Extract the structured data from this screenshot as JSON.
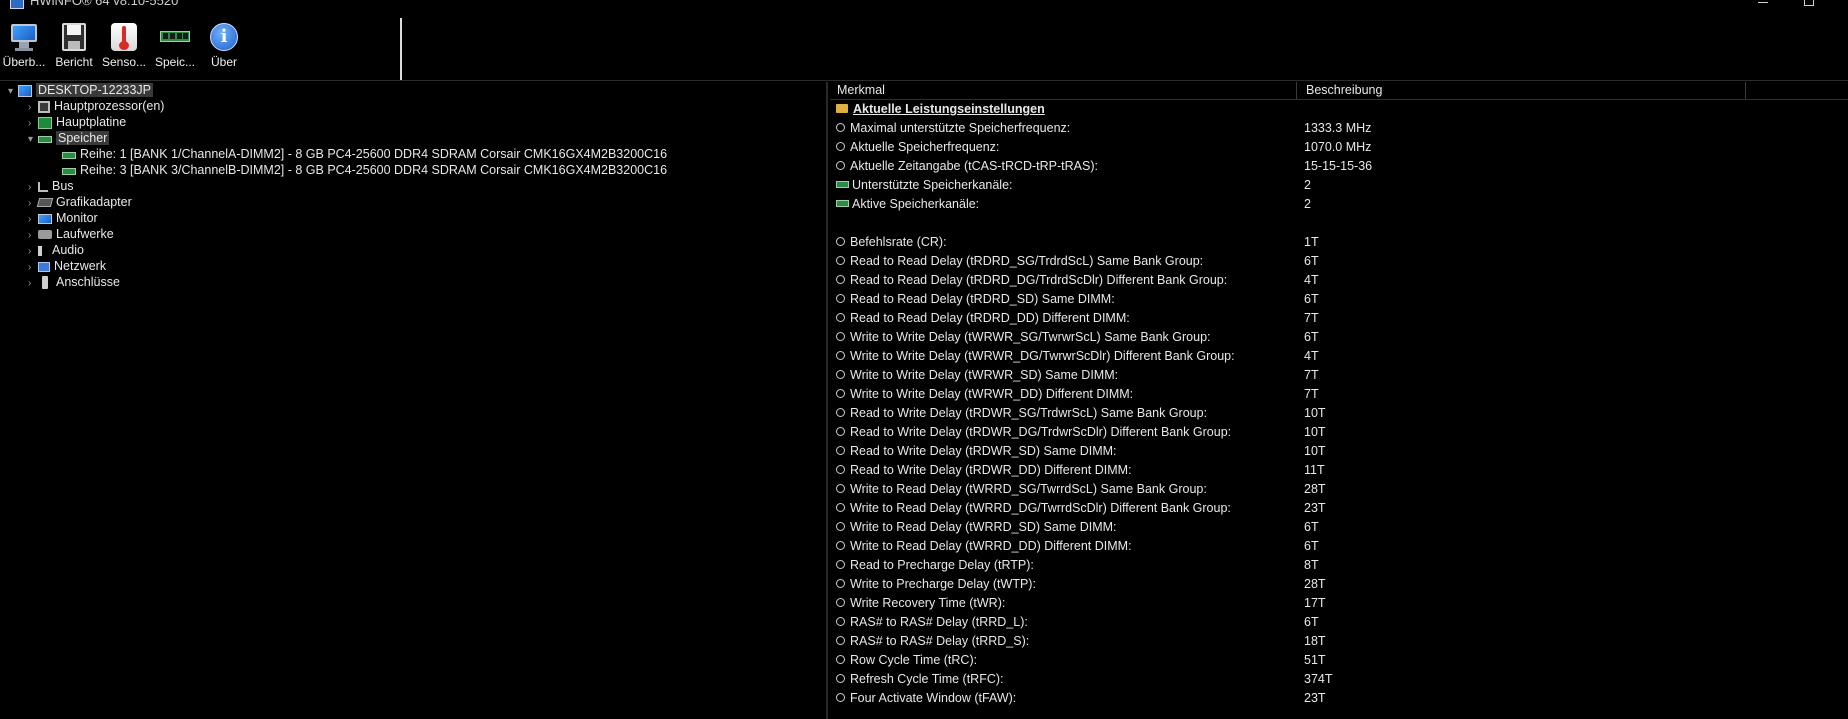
{
  "window": {
    "title": "HWiNFO® 64 v8.10-5520"
  },
  "toolbar": [
    {
      "label": "Überb...",
      "icon": "monitor-icon"
    },
    {
      "label": "Bericht",
      "icon": "save-icon"
    },
    {
      "label": "Senso...",
      "icon": "thermometer-icon"
    },
    {
      "label": "Speic...",
      "icon": "ram-icon"
    },
    {
      "label": "Über",
      "icon": "info-icon"
    }
  ],
  "tree": [
    {
      "label": "DESKTOP-12233JP",
      "icon": "computer-icon",
      "arrow": "▾",
      "level": 0,
      "selected": false
    },
    {
      "label": "Hauptprozessor(en)",
      "icon": "cpu-icon",
      "arrow": "›",
      "level": 1,
      "selected": false
    },
    {
      "label": "Hauptplatine",
      "icon": "motherboard-icon",
      "arrow": "›",
      "level": 1,
      "selected": false
    },
    {
      "label": "Speicher",
      "icon": "memory-icon",
      "arrow": "▾",
      "level": 1,
      "selected": true
    },
    {
      "label": "Reihe: 1 [BANK 1/ChannelA-DIMM2] - 8 GB PC4-25600 DDR4 SDRAM Corsair CMK16GX4M2B3200C16",
      "icon": "ram-module-icon",
      "arrow": "",
      "level": 2,
      "selected": false
    },
    {
      "label": "Reihe: 3 [BANK 3/ChannelB-DIMM2] - 8 GB PC4-25600 DDR4 SDRAM Corsair CMK16GX4M2B3200C16",
      "icon": "ram-module-icon",
      "arrow": "",
      "level": 2,
      "selected": false
    },
    {
      "label": "Bus",
      "icon": "bus-icon",
      "arrow": "›",
      "level": 1,
      "selected": false
    },
    {
      "label": "Grafikadapter",
      "icon": "gpu-icon",
      "arrow": "›",
      "level": 1,
      "selected": false
    },
    {
      "label": "Monitor",
      "icon": "monitor-icon",
      "arrow": "›",
      "level": 1,
      "selected": false
    },
    {
      "label": "Laufwerke",
      "icon": "drive-icon",
      "arrow": "›",
      "level": 1,
      "selected": false
    },
    {
      "label": "Audio",
      "icon": "audio-icon",
      "arrow": "›",
      "level": 1,
      "selected": false
    },
    {
      "label": "Netzwerk",
      "icon": "network-icon",
      "arrow": "›",
      "level": 1,
      "selected": false
    },
    {
      "label": "Anschlüsse",
      "icon": "port-icon",
      "arrow": "›",
      "level": 1,
      "selected": false
    }
  ],
  "table": {
    "columns": [
      "Merkmal",
      "Beschreibung"
    ],
    "rows": [
      {
        "type": "head",
        "key": "Aktuelle Leistungseinstellungen",
        "value": "",
        "icon": "folder-icon"
      },
      {
        "type": "item",
        "key": "Maximal unterstützte Speicherfrequenz:",
        "value": "1333.3 MHz",
        "icon": "clock-icon"
      },
      {
        "type": "item",
        "key": "Aktuelle Speicherfrequenz:",
        "value": "1070.0 MHz",
        "icon": "clock-icon"
      },
      {
        "type": "item",
        "key": "Aktuelle Zeitangabe (tCAS-tRCD-tRP-tRAS):",
        "value": "15-15-15-36",
        "icon": "clock-icon"
      },
      {
        "type": "item",
        "key": "Unterstützte Speicherkanäle:",
        "value": "2",
        "icon": "ram-icon"
      },
      {
        "type": "item",
        "key": "Aktive Speicherkanäle:",
        "value": "2",
        "icon": "ram-icon"
      },
      {
        "type": "blank",
        "key": "",
        "value": "",
        "icon": ""
      },
      {
        "type": "item",
        "key": "Befehlsrate (CR):",
        "value": "1T",
        "icon": "clock-icon"
      },
      {
        "type": "item",
        "key": "Read to Read Delay (tRDRD_SG/TrdrdScL) Same Bank Group:",
        "value": "6T",
        "icon": "clock-icon"
      },
      {
        "type": "item",
        "key": "Read to Read Delay (tRDRD_DG/TrdrdScDlr) Different Bank Group:",
        "value": "4T",
        "icon": "clock-icon"
      },
      {
        "type": "item",
        "key": "Read to Read Delay (tRDRD_SD) Same DIMM:",
        "value": "6T",
        "icon": "clock-icon"
      },
      {
        "type": "item",
        "key": "Read to Read Delay (tRDRD_DD) Different DIMM:",
        "value": "7T",
        "icon": "clock-icon"
      },
      {
        "type": "item",
        "key": "Write to Write Delay (tWRWR_SG/TwrwrScL) Same Bank Group:",
        "value": "6T",
        "icon": "clock-icon"
      },
      {
        "type": "item",
        "key": "Write to Write Delay (tWRWR_DG/TwrwrScDlr) Different Bank Group:",
        "value": "4T",
        "icon": "clock-icon"
      },
      {
        "type": "item",
        "key": "Write to Write Delay (tWRWR_SD) Same DIMM:",
        "value": "7T",
        "icon": "clock-icon"
      },
      {
        "type": "item",
        "key": "Write to Write Delay (tWRWR_DD) Different DIMM:",
        "value": "7T",
        "icon": "clock-icon"
      },
      {
        "type": "item",
        "key": "Read to Write Delay (tRDWR_SG/TrdwrScL) Same Bank Group:",
        "value": "10T",
        "icon": "clock-icon"
      },
      {
        "type": "item",
        "key": "Read to Write Delay (tRDWR_DG/TrdwrScDlr) Different Bank Group:",
        "value": "10T",
        "icon": "clock-icon"
      },
      {
        "type": "item",
        "key": "Read to Write Delay (tRDWR_SD) Same DIMM:",
        "value": "10T",
        "icon": "clock-icon"
      },
      {
        "type": "item",
        "key": "Read to Write Delay (tRDWR_DD) Different DIMM:",
        "value": "11T",
        "icon": "clock-icon"
      },
      {
        "type": "item",
        "key": "Write to Read Delay (tWRRD_SG/TwrrdScL) Same Bank Group:",
        "value": "28T",
        "icon": "clock-icon"
      },
      {
        "type": "item",
        "key": "Write to Read Delay (tWRRD_DG/TwrrdScDlr) Different Bank Group:",
        "value": "23T",
        "icon": "clock-icon"
      },
      {
        "type": "item",
        "key": "Write to Read Delay (tWRRD_SD) Same DIMM:",
        "value": "6T",
        "icon": "clock-icon"
      },
      {
        "type": "item",
        "key": "Write to Read Delay (tWRRD_DD) Different DIMM:",
        "value": "6T",
        "icon": "clock-icon"
      },
      {
        "type": "item",
        "key": "Read to Precharge Delay (tRTP):",
        "value": "8T",
        "icon": "clock-icon"
      },
      {
        "type": "item",
        "key": "Write to Precharge Delay (tWTP):",
        "value": "28T",
        "icon": "clock-icon"
      },
      {
        "type": "item",
        "key": "Write Recovery Time (tWR):",
        "value": "17T",
        "icon": "clock-icon"
      },
      {
        "type": "item",
        "key": "RAS# to RAS# Delay (tRRD_L):",
        "value": "6T",
        "icon": "clock-icon"
      },
      {
        "type": "item",
        "key": "RAS# to RAS# Delay (tRRD_S):",
        "value": "18T",
        "icon": "clock-icon"
      },
      {
        "type": "item",
        "key": "Row Cycle Time (tRC):",
        "value": "51T",
        "icon": "clock-icon"
      },
      {
        "type": "item",
        "key": "Refresh Cycle Time (tRFC):",
        "value": "374T",
        "icon": "clock-icon"
      },
      {
        "type": "item",
        "key": "Four Activate Window (tFAW):",
        "value": "23T",
        "icon": "clock-icon"
      }
    ]
  }
}
